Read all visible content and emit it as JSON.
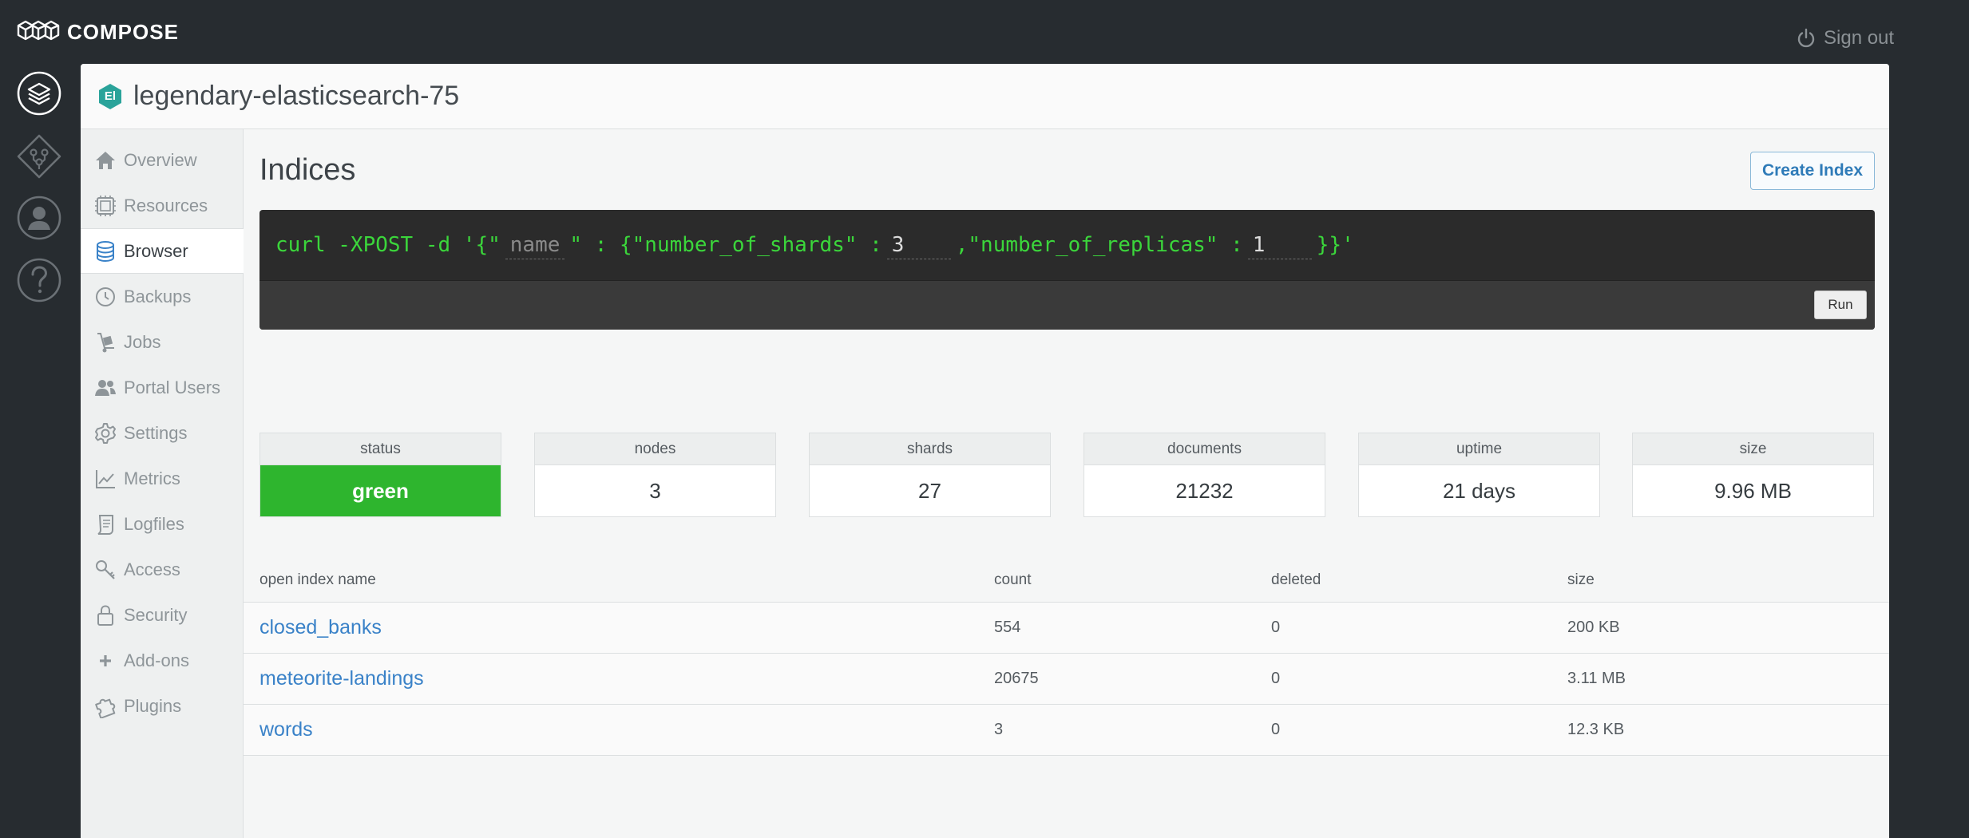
{
  "brand": {
    "name": "COMPOSE"
  },
  "header": {
    "signout_label": "Sign out"
  },
  "rail": {
    "icons": [
      "deployments-icon",
      "services-icon",
      "account-icon",
      "help-icon"
    ]
  },
  "deployment": {
    "badge": "El",
    "name": "legendary-elasticsearch-75",
    "badge_color": "#2aa39a"
  },
  "sidebar": {
    "items": [
      {
        "label": "Overview",
        "icon": "home-icon"
      },
      {
        "label": "Resources",
        "icon": "chip-icon"
      },
      {
        "label": "Browser",
        "icon": "database-icon",
        "active": true
      },
      {
        "label": "Backups",
        "icon": "history-icon"
      },
      {
        "label": "Jobs",
        "icon": "hand-truck-icon"
      },
      {
        "label": "Portal Users",
        "icon": "users-icon"
      },
      {
        "label": "Settings",
        "icon": "gear-icon"
      },
      {
        "label": "Metrics",
        "icon": "line-chart-icon"
      },
      {
        "label": "Logfiles",
        "icon": "scroll-icon"
      },
      {
        "label": "Access",
        "icon": "key-icon"
      },
      {
        "label": "Security",
        "icon": "lock-icon"
      },
      {
        "label": "Add-ons",
        "icon": "plus-icon"
      },
      {
        "label": "Plugins",
        "icon": "puzzle-icon"
      }
    ]
  },
  "main": {
    "title": "Indices",
    "create_button": "Create Index",
    "command": {
      "prefix": "curl -XPOST -d '{\"",
      "name_placeholder": "name",
      "middle": "\" : {\"number_of_shards\" :",
      "shards_value": "3",
      "replicas_label": ",\"number_of_replicas\" :",
      "replicas_value": "1",
      "suffix": "}}'",
      "run_label": "Run"
    },
    "stats": [
      {
        "label": "status",
        "value": "green",
        "color": "#2eb52e"
      },
      {
        "label": "nodes",
        "value": "3"
      },
      {
        "label": "shards",
        "value": "27"
      },
      {
        "label": "documents",
        "value": "21232"
      },
      {
        "label": "uptime",
        "value": "21 days"
      },
      {
        "label": "size",
        "value": "9.96 MB"
      }
    ],
    "table": {
      "headers": {
        "name": "open index name",
        "count": "count",
        "deleted": "deleted",
        "size": "size"
      },
      "rows": [
        {
          "name": "closed_banks",
          "count": "554",
          "deleted": "0",
          "size": "200 KB"
        },
        {
          "name": "meteorite-landings",
          "count": "20675",
          "deleted": "0",
          "size": "3.11 MB"
        },
        {
          "name": "words",
          "count": "3",
          "deleted": "0",
          "size": "12.3 KB"
        }
      ]
    }
  },
  "colors": {
    "background": "#272c30",
    "accent": "#3a82c8",
    "command_text": "#3bd63b",
    "status_ok": "#2eb52e"
  }
}
